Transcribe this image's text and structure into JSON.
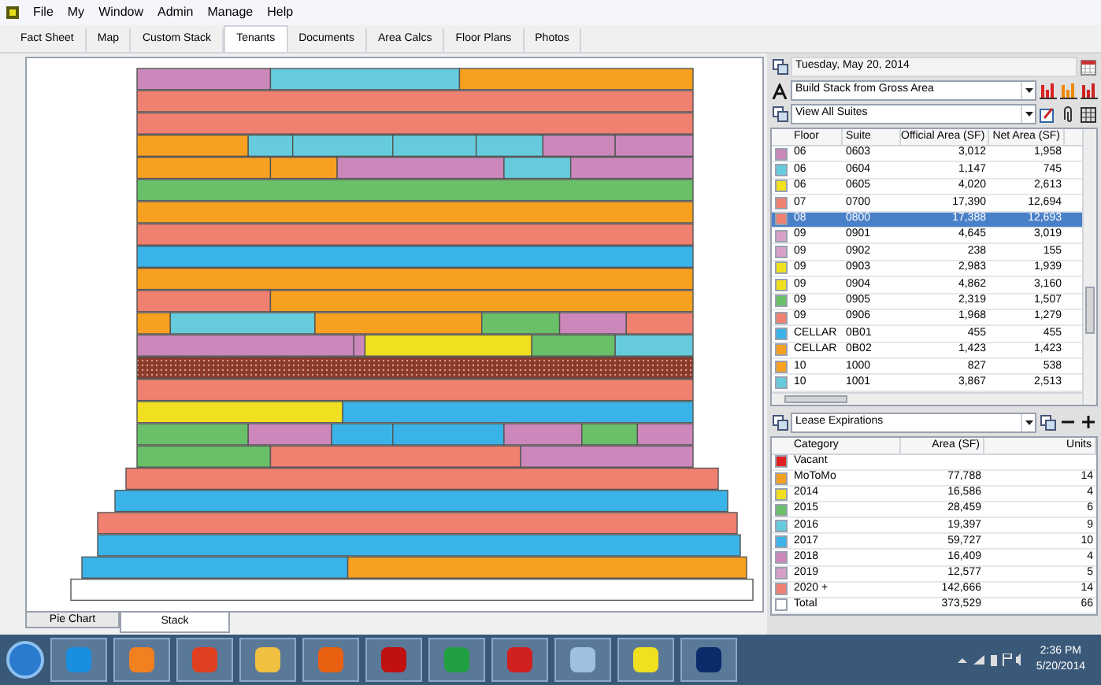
{
  "menu": [
    "File",
    "My",
    "Window",
    "Admin",
    "Manage",
    "Help"
  ],
  "tabs": [
    {
      "label": "Fact Sheet",
      "selected": false
    },
    {
      "label": "Map",
      "selected": false
    },
    {
      "label": "Custom Stack",
      "selected": false
    },
    {
      "label": "Tenants",
      "selected": true
    },
    {
      "label": "Documents",
      "selected": false
    },
    {
      "label": "Area Calcs",
      "selected": false
    },
    {
      "label": "Floor Plans",
      "selected": false
    },
    {
      "label": "Photos",
      "selected": false
    }
  ],
  "view_tabs": [
    {
      "label": "Pie Chart",
      "selected": false
    },
    {
      "label": "Stack",
      "selected": true
    }
  ],
  "date_field": {
    "value": "Tuesday, May 20, 2014"
  },
  "stack_source": {
    "value": "Build Stack from Gross Area"
  },
  "suite_filter": {
    "value": "View All Suites"
  },
  "suites_table": {
    "columns": [
      "Floor",
      "Suite",
      "Official Area (SF)",
      "Net Area (SF)"
    ],
    "rows": [
      {
        "color": "#cc88bb",
        "floor": "06",
        "suite": "0603",
        "official_area": "3,012",
        "net_area": "1,958",
        "selected": false
      },
      {
        "color": "#66ccdd",
        "floor": "06",
        "suite": "0604",
        "official_area": "1,147",
        "net_area": "745",
        "selected": false
      },
      {
        "color": "#f0e020",
        "floor": "06",
        "suite": "0605",
        "official_area": "4,020",
        "net_area": "2,613",
        "selected": false
      },
      {
        "color": "#f08070",
        "floor": "07",
        "suite": "0700",
        "official_area": "17,390",
        "net_area": "12,694",
        "selected": false
      },
      {
        "color": "#f08070",
        "floor": "08",
        "suite": "0800",
        "official_area": "17,388",
        "net_area": "12,693",
        "selected": true
      },
      {
        "color": "#d8a0c8",
        "floor": "09",
        "suite": "0901",
        "official_area": "4,645",
        "net_area": "3,019",
        "selected": false
      },
      {
        "color": "#d8a0c8",
        "floor": "09",
        "suite": "0902",
        "official_area": "238",
        "net_area": "155",
        "selected": false
      },
      {
        "color": "#f0e020",
        "floor": "09",
        "suite": "0903",
        "official_area": "2,983",
        "net_area": "1,939",
        "selected": false
      },
      {
        "color": "#f0e020",
        "floor": "09",
        "suite": "0904",
        "official_area": "4,862",
        "net_area": "3,160",
        "selected": false
      },
      {
        "color": "#6abf69",
        "floor": "09",
        "suite": "0905",
        "official_area": "2,319",
        "net_area": "1,507",
        "selected": false
      },
      {
        "color": "#f08070",
        "floor": "09",
        "suite": "0906",
        "official_area": "1,968",
        "net_area": "1,279",
        "selected": false
      },
      {
        "color": "#3ab4e8",
        "floor": "CELLAR",
        "suite": "0B01",
        "official_area": "455",
        "net_area": "455",
        "selected": false
      },
      {
        "color": "#f8a020",
        "floor": "CELLAR",
        "suite": "0B02",
        "official_area": "1,423",
        "net_area": "1,423",
        "selected": false
      },
      {
        "color": "#f8a020",
        "floor": "10",
        "suite": "1000",
        "official_area": "827",
        "net_area": "538",
        "selected": false
      },
      {
        "color": "#66ccdd",
        "floor": "10",
        "suite": "1001",
        "official_area": "3,867",
        "net_area": "2,513",
        "selected": false
      }
    ]
  },
  "legend_select": {
    "value": "Lease Expirations"
  },
  "legend_table": {
    "columns": [
      "Category",
      "Area (SF)",
      "Units"
    ],
    "rows": [
      {
        "color": "#e02020",
        "category": "Vacant"
      },
      {
        "color": "#f8a020",
        "category": "MoToMo",
        "area": "77,788",
        "units": "14"
      },
      {
        "color": "#f0e020",
        "category": "2014",
        "area": "16,586",
        "units": "4"
      },
      {
        "color": "#6abf69",
        "category": "2015",
        "area": "28,459",
        "units": "6"
      },
      {
        "color": "#66ccdd",
        "category": "2016",
        "area": "19,397",
        "units": "9"
      },
      {
        "color": "#3ab4e8",
        "category": "2017",
        "area": "59,727",
        "units": "10"
      },
      {
        "color": "#cc88bb",
        "category": "2018",
        "area": "16,409",
        "units": "4"
      },
      {
        "color": "#d8a0c8",
        "category": "2019",
        "area": "12,577",
        "units": "5"
      },
      {
        "color": "#f08070",
        "category": "2020 +",
        "area": "142,666",
        "units": "14"
      },
      {
        "category": "Total",
        "area": "373,529",
        "units": "66"
      }
    ]
  },
  "taskbar": {
    "time": "2:36 PM",
    "date": "5/20/2014"
  }
}
